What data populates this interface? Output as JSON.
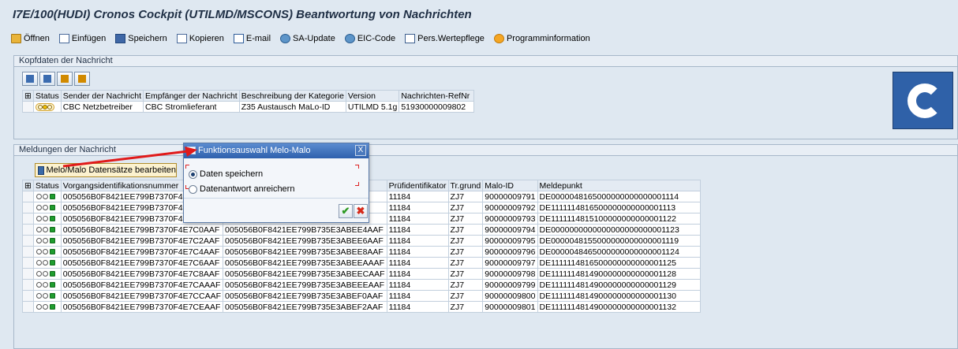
{
  "window": {
    "title": "I7E/100(HUDI) Cronos Cockpit (UTILMD/MSCONS)  Beantwortung von Nachrichten"
  },
  "toolbar": {
    "items": [
      {
        "label": "Öffnen",
        "icon": "open-folder-icon"
      },
      {
        "label": "Einfügen",
        "icon": "insert-icon"
      },
      {
        "label": "Speichern",
        "icon": "save-icon"
      },
      {
        "label": "Kopieren",
        "icon": "copy-icon"
      },
      {
        "label": "E-mail",
        "icon": "mail-icon"
      },
      {
        "label": "SA-Update",
        "icon": "globe-icon"
      },
      {
        "label": "EIC-Code",
        "icon": "globe-icon"
      },
      {
        "label": "Pers.Wertepflege",
        "icon": "table-icon"
      },
      {
        "label": "Programminformation",
        "icon": "info-icon"
      }
    ]
  },
  "header_group": {
    "title": "Kopfdaten der Nachricht",
    "columns": [
      "Status",
      "Sender der Nachricht",
      "Empfänger der Nachricht",
      "Beschreibung der Kategorie",
      "Version",
      "Nachrichten-RefNr"
    ],
    "rows": [
      {
        "sender": "CBC Netzbetreiber",
        "empfaenger": "CBC Stromlieferant",
        "beschreibung": "Z35 Austausch MaLo-ID",
        "version": "UTILMD 5.1g",
        "refnr": "51930000009802"
      }
    ]
  },
  "messages_group": {
    "title": "Meldungen der Nachricht",
    "action_button": "Melo/Malo Datensätze bearbeiten",
    "columns": [
      "Status",
      "Vorgangsidentifikationsnummer",
      "",
      "Prüfidentifikator",
      "Tr.grund",
      "Malo-ID",
      "Meldepunkt"
    ],
    "rows": [
      {
        "vid": "005056B0F8421EE799B7370F4E",
        "ref": "...AF",
        "pid": "11184",
        "tr": "ZJ7",
        "malo": "90000009791",
        "melde": "DE0000048165000000000000001114"
      },
      {
        "vid": "005056B0F8421EE799B7370F4E",
        "ref": "...AF",
        "pid": "11184",
        "tr": "ZJ7",
        "malo": "90000009792",
        "melde": "DE1111114816500000000000001113"
      },
      {
        "vid": "005056B0F8421EE799B7370F4E",
        "ref": "...AF",
        "pid": "11184",
        "tr": "ZJ7",
        "malo": "90000009793",
        "melde": "DE1111114815100000000000001122"
      },
      {
        "vid": "005056B0F8421EE799B7370F4E7C0AAF",
        "ref": "005056B0F8421EE799B735E3ABEE4AAF",
        "pid": "11184",
        "tr": "ZJ7",
        "malo": "90000009794",
        "melde": "DE0000000000000000000000001123"
      },
      {
        "vid": "005056B0F8421EE799B7370F4E7C2AAF",
        "ref": "005056B0F8421EE799B735E3ABEE6AAF",
        "pid": "11184",
        "tr": "ZJ7",
        "malo": "90000009795",
        "melde": "DE0000048155000000000000001119"
      },
      {
        "vid": "005056B0F8421EE799B7370F4E7C4AAF",
        "ref": "005056B0F8421EE799B735E3ABEE8AAF",
        "pid": "11184",
        "tr": "ZJ7",
        "malo": "90000009796",
        "melde": "DE0000048465000000000000001124"
      },
      {
        "vid": "005056B0F8421EE799B7370F4E7C6AAF",
        "ref": "005056B0F8421EE799B735E3ABEEAAAF",
        "pid": "11184",
        "tr": "ZJ7",
        "malo": "90000009797",
        "melde": "DE1111114816500000000000001125"
      },
      {
        "vid": "005056B0F8421EE799B7370F4E7C8AAF",
        "ref": "005056B0F8421EE799B735E3ABEECAAF",
        "pid": "11184",
        "tr": "ZJ7",
        "malo": "90000009798",
        "melde": "DE1111114814900000000000001128"
      },
      {
        "vid": "005056B0F8421EE799B7370F4E7CAAAF",
        "ref": "005056B0F8421EE799B735E3ABEEEAAF",
        "pid": "11184",
        "tr": "ZJ7",
        "malo": "90000009799",
        "melde": "DE1111114814900000000000001129"
      },
      {
        "vid": "005056B0F8421EE799B7370F4E7CCAAF",
        "ref": "005056B0F8421EE799B735E3ABEF0AAF",
        "pid": "11184",
        "tr": "ZJ7",
        "malo": "90000009800",
        "melde": "DE1111114814900000000000001130"
      },
      {
        "vid": "005056B0F8421EE799B7370F4E7CEAAF",
        "ref": "005056B0F8421EE799B735E3ABEF2AAF",
        "pid": "11184",
        "tr": "ZJ7",
        "malo": "90000009801",
        "melde": "DE1111114814900000000000001132"
      }
    ]
  },
  "dialog": {
    "title": "Funktionsauswahl Melo-Malo",
    "close": "X",
    "options": [
      "Daten speichern",
      "Datenantwort anreichern"
    ],
    "selected_option": "Daten speichern",
    "ok": "✔",
    "cancel": "✖"
  },
  "colors": {
    "accent": "#2e61ad",
    "arrow": "#e01a1a",
    "status_green": "#1f9d2e"
  }
}
